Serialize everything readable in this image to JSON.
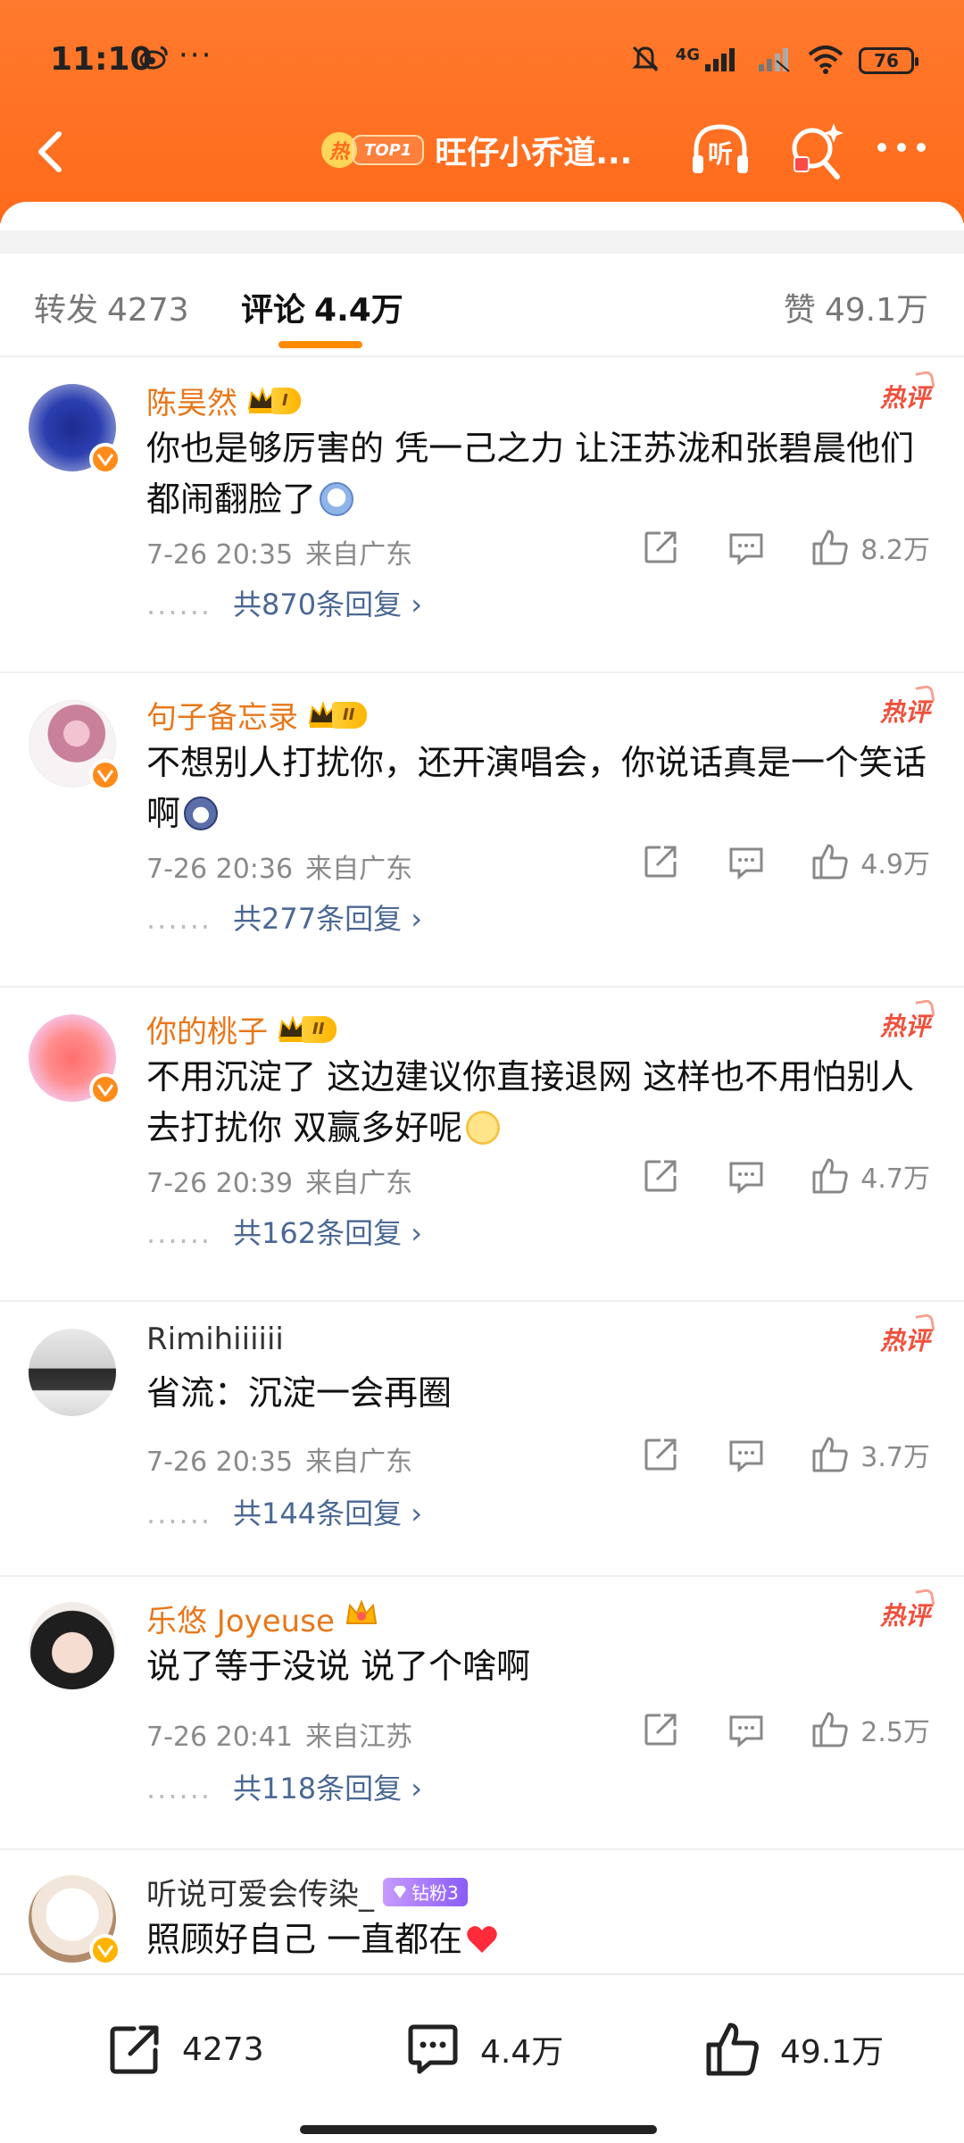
{
  "status_bar": {
    "time": "11:10",
    "dots": "···",
    "network": "4G",
    "battery": "76"
  },
  "header": {
    "hot_label": "热",
    "top_label": "TOP1",
    "title": "旺仔小乔道..."
  },
  "tabs": {
    "repost": {
      "label": "转发",
      "count": "4273"
    },
    "comment": {
      "label": "评论",
      "count": "4.4万"
    },
    "like": {
      "label": "赞",
      "count": "49.1万"
    }
  },
  "hot_tag": "热评",
  "comments": [
    {
      "user": "陈昊然",
      "level": "I",
      "text": "你也是够厉害的 凭一己之力 让汪苏泷和张碧晨他们都闹翻脸了",
      "time": "7-26 20:35",
      "location": "来自广东",
      "likes": "8.2万",
      "replies": "共870条回复 ›"
    },
    {
      "user": "句子备忘录",
      "level": "II",
      "text": "不想别人打扰你，还开演唱会，你说话真是一个笑话啊",
      "time": "7-26 20:36",
      "location": "来自广东",
      "likes": "4.9万",
      "replies": "共277条回复 ›"
    },
    {
      "user": "你的桃子",
      "level": "II",
      "text": "不用沉淀了 这边建议你直接退网 这样也不用怕别人去打扰你 双赢多好呢",
      "time": "7-26 20:39",
      "location": "来自广东",
      "likes": "4.7万",
      "replies": "共162条回复 ›"
    },
    {
      "user": "Rimihiiiiii",
      "text": "省流：沉淀一会再圈",
      "time": "7-26 20:35",
      "location": "来自广东",
      "likes": "3.7万",
      "replies": "共144条回复 ›"
    },
    {
      "user": "乐悠 Joyeuse",
      "text": "说了等于没说 说了个啥啊",
      "time": "7-26 20:41",
      "location": "来自江苏",
      "likes": "2.5万",
      "replies": "共118条回复 ›"
    },
    {
      "user": "听说可爱会传染_",
      "fan_badge": "钻粉3",
      "text": "照顾好自己 一直都在"
    }
  ],
  "replies_dots": "......",
  "bottom_bar": {
    "repost_count": "4273",
    "comment_count": "4.4万",
    "like_count": "49.1万"
  },
  "colors": {
    "header_orange": "#ff6a1a",
    "accent_orange": "#ff8a00",
    "username_orange": "#e8771b",
    "hot_red": "#f0503c",
    "reply_blue": "#4b6894"
  }
}
